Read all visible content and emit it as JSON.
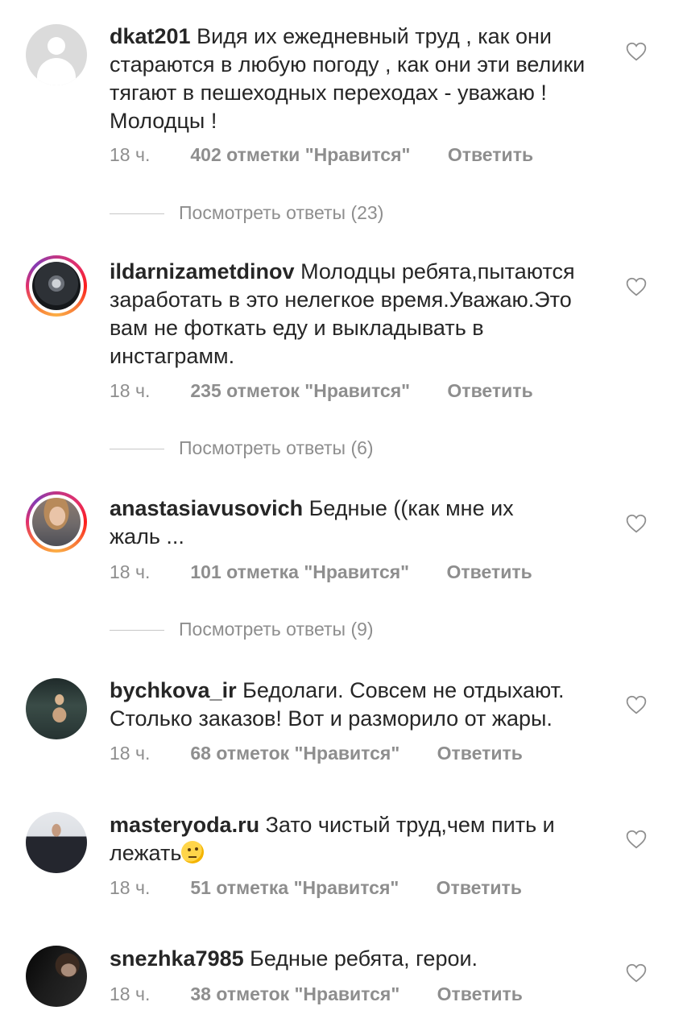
{
  "comments": [
    {
      "username": "dkat201",
      "text": "Видя их ежедневный труд , как они стараются в любую погоду , как они эти велики тягают в пешеходных переходах - уважаю ! Молодцы !",
      "time": "18 ч.",
      "likes": "402 отметки \"Нравится\"",
      "reply": "Ответить",
      "view_replies": "Посмотреть ответы (23)",
      "avatar": "default-avatar-icon"
    },
    {
      "username": "ildarnizametdinov",
      "text": "Молодцы ребята,пытаются заработать в это нелегкое время.Уважаю.Это вам не фоткать еду и выкладывать в инстаграмм.",
      "time": "18 ч.",
      "likes": "235 отметок \"Нравится\"",
      "reply": "Ответить",
      "view_replies": "Посмотреть ответы (6)",
      "avatar": "car-interior-photo"
    },
    {
      "username": "anastasiavusovich",
      "text": "Бедные ((как мне их жаль ...",
      "time": "18 ч.",
      "likes": "101 отметка \"Нравится\"",
      "reply": "Ответить",
      "view_replies": "Посмотреть ответы (9)",
      "avatar": "woman-portrait-photo"
    },
    {
      "username": "bychkova_ir",
      "text": "Бедолаги. Совсем не отдыхают. Столько заказов! Вот и разморило от жары.",
      "time": "18 ч.",
      "likes": "68 отметок \"Нравится\"",
      "reply": "Ответить",
      "avatar": "poolside-photo"
    },
    {
      "username": "masteryoda.ru",
      "text": "Зато чистый труд,чем пить и лежать",
      "emoji": "thinking-face-emoji",
      "time": "18 ч.",
      "likes": "51 отметка \"Нравится\"",
      "reply": "Ответить",
      "avatar": "gym-photo"
    },
    {
      "username": "snezhka7985",
      "text": "Бедные ребята, герои.",
      "time": "18 ч.",
      "likes": "38 отметок \"Нравится\"",
      "reply": "Ответить",
      "avatar": "dark-portrait-photo"
    }
  ],
  "colors": {
    "text": "#262626",
    "secondary": "#8e8e8e",
    "divider": "#c7c7c7",
    "story_ring_start": "#c13584",
    "story_ring_end": "#fcaf45"
  }
}
